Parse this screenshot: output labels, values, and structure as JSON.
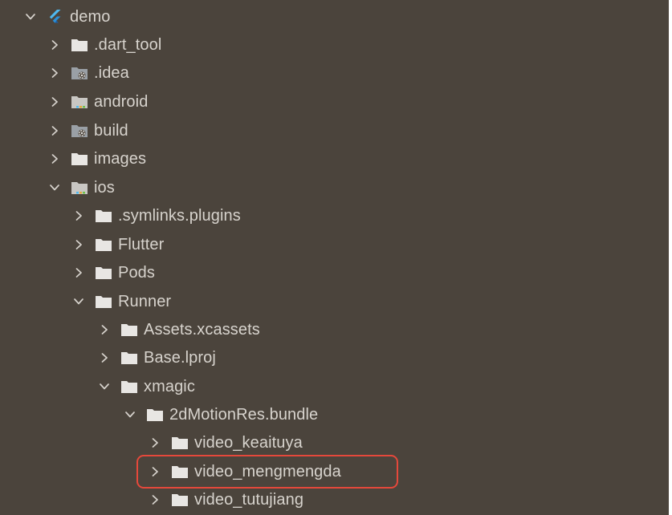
{
  "tree": {
    "items": [
      {
        "label": "demo",
        "expanded": true,
        "icon": "flutter-logo-icon"
      },
      {
        "label": ".dart_tool",
        "expanded": false,
        "icon": "folder-icon"
      },
      {
        "label": ".idea",
        "expanded": false,
        "icon": "config-folder-icon"
      },
      {
        "label": "android",
        "expanded": false,
        "icon": "module-folder-icon"
      },
      {
        "label": "build",
        "expanded": false,
        "icon": "config-folder-icon"
      },
      {
        "label": "images",
        "expanded": false,
        "icon": "folder-icon"
      },
      {
        "label": "ios",
        "expanded": true,
        "icon": "module-folder-icon"
      },
      {
        "label": ".symlinks.plugins",
        "expanded": false,
        "icon": "folder-icon"
      },
      {
        "label": "Flutter",
        "expanded": false,
        "icon": "folder-icon"
      },
      {
        "label": "Pods",
        "expanded": false,
        "icon": "folder-icon"
      },
      {
        "label": "Runner",
        "expanded": true,
        "icon": "folder-icon"
      },
      {
        "label": "Assets.xcassets",
        "expanded": false,
        "icon": "folder-icon"
      },
      {
        "label": "Base.lproj",
        "expanded": false,
        "icon": "folder-icon"
      },
      {
        "label": "xmagic",
        "expanded": true,
        "icon": "folder-icon"
      },
      {
        "label": "2dMotionRes.bundle",
        "expanded": true,
        "icon": "folder-icon"
      },
      {
        "label": "video_keaituya",
        "expanded": false,
        "icon": "folder-icon"
      },
      {
        "label": "video_mengmengda",
        "expanded": false,
        "icon": "folder-icon",
        "highlighted": true
      },
      {
        "label": "video_tutujiang",
        "expanded": false,
        "icon": "folder-icon"
      }
    ]
  },
  "colors": {
    "background": "#4b443c",
    "text": "#d7d3cd",
    "chevron": "#d7d3cd",
    "folder": "#e8e6e3",
    "highlight_border": "#e5483b",
    "flutter_blue": "#4fb9ef"
  }
}
